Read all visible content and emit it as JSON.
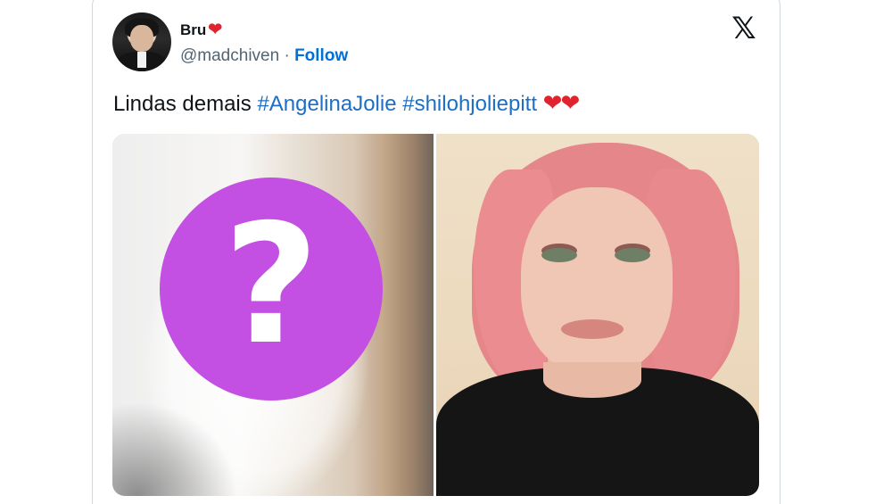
{
  "tweet": {
    "user_name": "Bru",
    "name_emoji": "❤",
    "handle": "@madchiven",
    "separator": "·",
    "follow_label": "Follow",
    "text_prefix": "Lindas demais",
    "hashtag_1": "#AngelinaJolie",
    "hashtag_2": "#shilohjoliepitt",
    "text_emojis": "❤❤"
  },
  "platform": {
    "logo_glyph": "𝕏"
  },
  "media": {
    "placeholder_glyph": "?"
  },
  "colors": {
    "link": "#1d6fc4",
    "follow": "#006fd6",
    "heart": "#e0242f",
    "placeholder_circle": "#c44fe3"
  }
}
